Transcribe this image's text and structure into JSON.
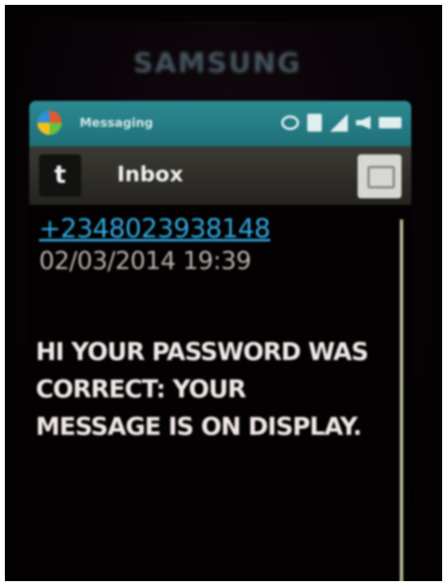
{
  "device": {
    "brand": "SAMSUNG"
  },
  "status_bar": {
    "app_title": "Messaging",
    "icons": [
      "windows-logo-icon",
      "chat-icon",
      "note-icon",
      "signal-icon",
      "speaker-icon",
      "battery-icon"
    ]
  },
  "header": {
    "back_icon_glyph": "t",
    "title": "Inbox"
  },
  "message": {
    "sender": "+2348023938148",
    "timestamp": "02/03/2014 19:39",
    "body": "HI YOUR PASSWORD WAS\nCORRECT: YOUR\nMESSAGE IS ON DISPLAY."
  },
  "colors": {
    "status_bar": "#2d8a92",
    "sender_link": "#2fa8df",
    "body_text": "#f0e8e6",
    "timestamp_text": "#b9b1ad"
  }
}
